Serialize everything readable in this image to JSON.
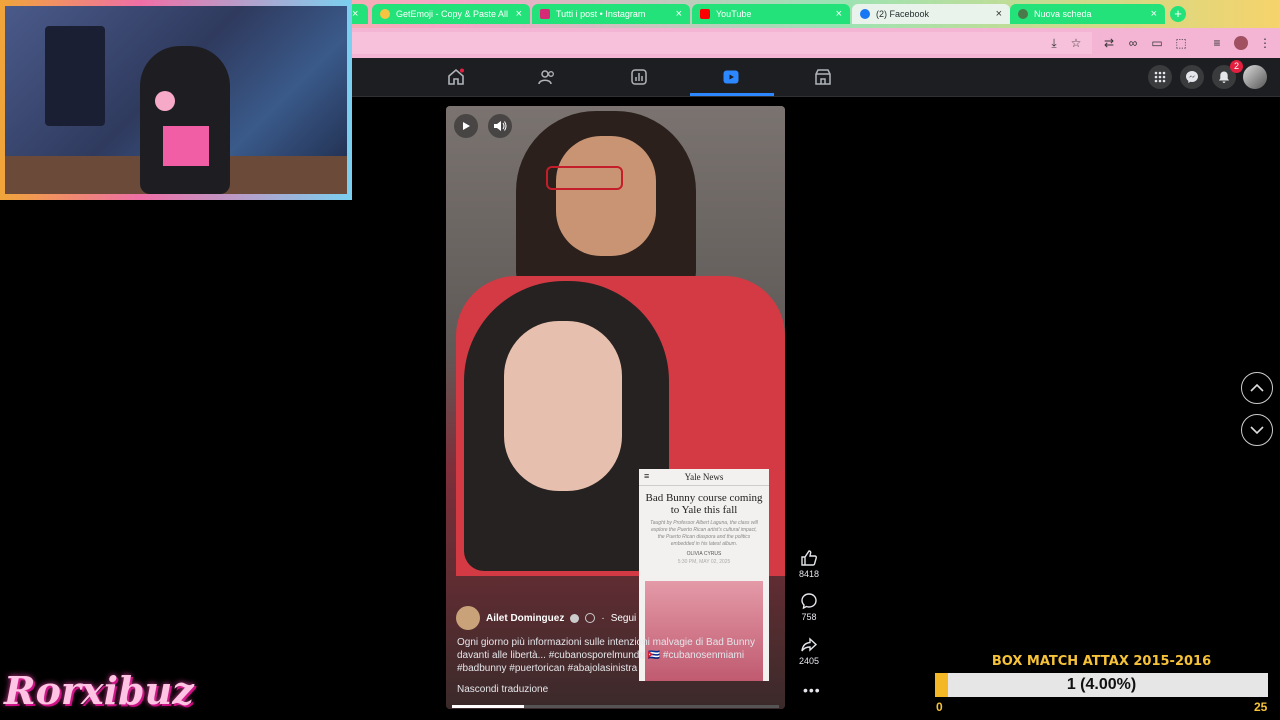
{
  "browser": {
    "tabs": [
      {
        "label": "GetEmoji - Copy & Paste All",
        "active": false,
        "icon_color": "#f5c542"
      },
      {
        "label": "Tutti i post • Instagram",
        "active": false,
        "icon_color": "#d62976"
      },
      {
        "label": "YouTube",
        "active": false,
        "icon_color": "#ff0000"
      },
      {
        "label": "(2) Facebook",
        "active": true,
        "icon_color": "#1877f2"
      },
      {
        "label": "Nuova scheda",
        "active": false,
        "icon_color": "#4a7a4a"
      }
    ],
    "new_tab": "+"
  },
  "facebook": {
    "nav": [
      "home-icon",
      "friends-icon",
      "dashboard-icon",
      "video-icon",
      "marketplace-icon"
    ],
    "active_nav": "video-icon",
    "notification_count": "2",
    "accent": "#2d88ff"
  },
  "reel": {
    "author": "Ailet Dominguez",
    "separator": "·",
    "follow": "Segui",
    "caption": "Ogni giorno più informazioni sulle intenzioni malvagie di Bad Bunny davanti alle libertà... #cubanosporelmundo 🇨🇺 #cubanosenmiami #badbunny #puertorican #abajolasinistra",
    "translate_toggle": "Nascondi traduzione",
    "progress": 0.22,
    "likes": "8418",
    "comments": "758",
    "shares": "2405",
    "more": "•••",
    "article": {
      "masthead": "Yale News",
      "headline": "Bad Bunny course coming to Yale this fall",
      "dek": "Taught by Professor Albert Laguna, the class will explore the Puerto Rican artist's cultural impact, the Puerto Rican diaspora and the politics embedded in his latest album.",
      "author": "OLIVIA CYRUS",
      "date": "5:30 PM, MAY 02, 2025"
    }
  },
  "overlay": {
    "brand": "Rorxibuz",
    "box_title": "BOX MATCH ATTAX 2015-2016",
    "box_progress_label": "1 (4.00%)",
    "box_progress": 0.04,
    "box_min": "0",
    "box_max": "25"
  }
}
